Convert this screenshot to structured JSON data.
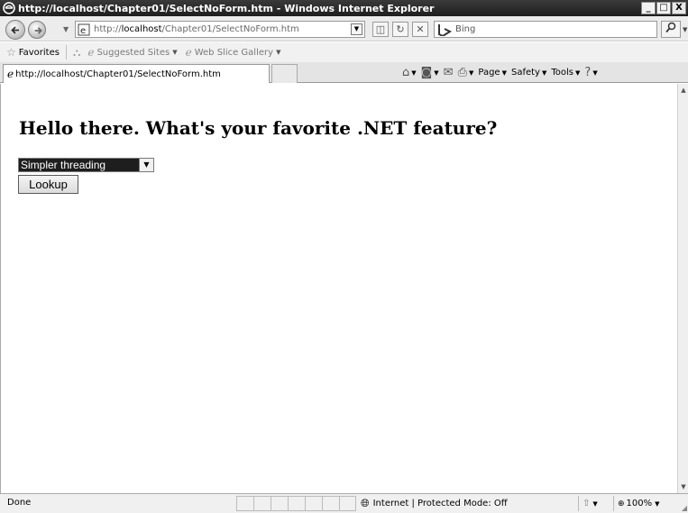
{
  "window": {
    "title": "http://localhost/Chapter01/SelectNoForm.htm - Windows Internet Explorer",
    "controls": {
      "minimize": "_",
      "maximize": "□",
      "close": "X"
    }
  },
  "address_bar": {
    "url_prefix": "http://",
    "url_host": "localhost",
    "url_path": "/Chapter01/SelectNoForm.htm"
  },
  "search": {
    "placeholder": "Bing"
  },
  "favorites_bar": {
    "favorites_label": "Favorites",
    "items": [
      {
        "label": "Suggested Sites"
      },
      {
        "label": "Web Slice Gallery"
      }
    ]
  },
  "tab": {
    "label": "http://localhost/Chapter01/SelectNoForm.htm"
  },
  "command_bar": {
    "page_label": "Page",
    "safety_label": "Safety",
    "tools_label": "Tools"
  },
  "page": {
    "heading": "Hello there. What's your favorite .NET feature?",
    "select": {
      "selected": "Simpler threading"
    },
    "lookup_label": "Lookup"
  },
  "status_bar": {
    "status": "Done",
    "zone": "Internet | Protected Mode: Off",
    "zoom": "100%"
  },
  "icons": {
    "ie_logo": "ie-logo-icon",
    "back": "back-arrow-icon",
    "forward": "forward-arrow-icon",
    "refresh": "refresh-icon",
    "stop": "stop-icon",
    "search": "search-icon",
    "home": "home-icon",
    "feeds": "feeds-icon",
    "mail": "mail-icon",
    "print": "print-icon",
    "help": "help-icon",
    "globe": "globe-icon"
  }
}
